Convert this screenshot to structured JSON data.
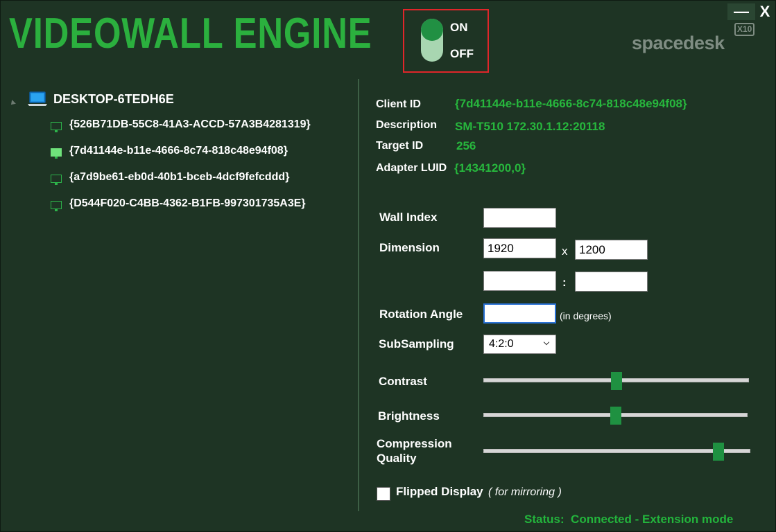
{
  "app": {
    "title": "VIDEOWALL ENGINE",
    "brand": "spacedesk",
    "brand_badge": "X10",
    "minimize": "—",
    "close": "X"
  },
  "toggle": {
    "on_label": "ON",
    "off_label": "OFF",
    "state": "ON"
  },
  "tree": {
    "root": "DESKTOP-6TEDH6E",
    "items": [
      {
        "label": "{526B71DB-55C8-41A3-ACCD-57A3B4281319}",
        "selected": false
      },
      {
        "label": "{7d41144e-b11e-4666-8c74-818c48e94f08}",
        "selected": true
      },
      {
        "label": "{a7d9be61-eb0d-40b1-bceb-4dcf9fefcddd}",
        "selected": false
      },
      {
        "label": "{D544F020-C4BB-4362-B1FB-997301735A3E}",
        "selected": false
      }
    ]
  },
  "info": {
    "client_id_label": "Client ID",
    "client_id": "{7d41144e-b11e-4666-8c74-818c48e94f08}",
    "description_label": "Description",
    "description": "SM-T510 172.30.1.12:20118",
    "target_id_label": "Target ID",
    "target_id": "256",
    "adapter_luid_label": "Adapter LUID",
    "adapter_luid": "{14341200,0}"
  },
  "form": {
    "wall_index_label": "Wall Index",
    "wall_index": "",
    "dimension_label": "Dimension",
    "width": "1920",
    "height": "1200",
    "x_sep": "x",
    "ratio_a": "",
    "ratio_b": "",
    "colon": ":",
    "rotation_label": "Rotation Angle",
    "rotation": "",
    "rotation_hint": "(in degrees)",
    "subsampling_label": "SubSampling",
    "subsampling": "4:2:0",
    "contrast_label": "Contrast",
    "contrast_level": 0.5,
    "brightness_label": "Brightness",
    "brightness_level": 0.5,
    "compression_label_1": "Compression",
    "compression_label_2": "Quality",
    "compression_level": 0.88,
    "flipped_label": "Flipped Display",
    "flipped_hint": "( for mirroring )",
    "flipped": false
  },
  "status": {
    "text": "Status:  Connected - Extension mode"
  },
  "colors": {
    "accent": "#2bb03e",
    "background": "#1e3424",
    "highlight_box": "#e0262a"
  }
}
